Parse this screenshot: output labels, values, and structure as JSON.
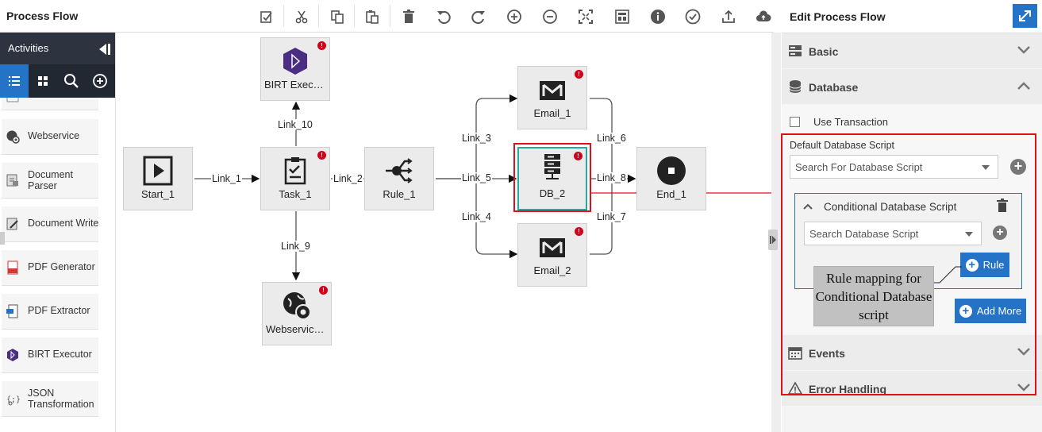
{
  "header": {
    "title": "Process Flow",
    "toolbar": [
      "save-icon",
      "cut-icon",
      "copy-icon",
      "paste-icon",
      "delete-icon",
      "undo-icon",
      "redo-icon",
      "zoom-in-icon",
      "zoom-out-icon",
      "fit-screen-icon",
      "grid-icon",
      "info-icon",
      "validate-icon",
      "export-icon",
      "publish-icon"
    ]
  },
  "palette": {
    "title": "Activities",
    "items": [
      {
        "label": "Webservice",
        "icon": "webservice-icon"
      },
      {
        "label": "Document\nParser",
        "icon": "document-parser-icon"
      },
      {
        "label": "Document Write",
        "icon": "document-writer-icon"
      },
      {
        "label": "PDF Generator",
        "icon": "pdf-generator-icon"
      },
      {
        "label": "PDF Extractor",
        "icon": "pdf-extractor-icon"
      },
      {
        "label": "BIRT Executor",
        "icon": "birt-icon"
      },
      {
        "label": "JSON\nTransformation",
        "icon": "json-icon"
      }
    ]
  },
  "canvas": {
    "nodes": {
      "birt": "BIRT Execu...",
      "start": "Start_1",
      "task": "Task_1",
      "rule": "Rule_1",
      "email1": "Email_1",
      "db": "DB_2",
      "email2": "Email_2",
      "end": "End_1",
      "webservice": "Webservice..."
    },
    "links": {
      "l1": "Link_1",
      "l2": "Link_2",
      "l3": "Link_3",
      "l4": "Link_4",
      "l5": "Link_5",
      "l6": "Link_6",
      "l7": "Link_7",
      "l8": "Link_8",
      "l9": "Link_9",
      "l10": "Link_10"
    }
  },
  "panel": {
    "title": "Edit Process Flow",
    "sections": {
      "basic": "Basic",
      "database": "Database",
      "events": "Events",
      "error": "Error Handling"
    },
    "use_transaction": "Use Transaction",
    "default_script_label": "Default Database Script",
    "default_script_placeholder": "Search For Database Script",
    "conditional_title": "Conditional Database Script",
    "conditional_placeholder": "Search Database Script",
    "rule_button": "Rule",
    "add_more_button": "Add More"
  },
  "callout": {
    "text": "Rule mapping for Conditional Database script"
  },
  "colors": {
    "accent": "#2473c7",
    "highlight": "#e0101a",
    "error": "#d0021b"
  }
}
